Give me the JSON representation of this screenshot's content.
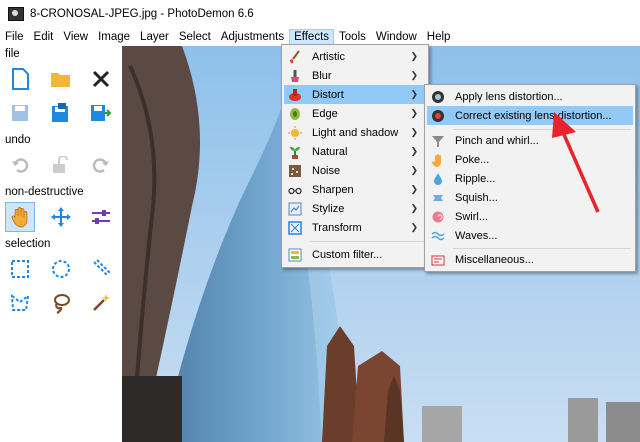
{
  "window": {
    "title": "8-CRONOSAL-JPEG.jpg - PhotoDemon 6.6"
  },
  "menubar": [
    "File",
    "Edit",
    "View",
    "Image",
    "Layer",
    "Select",
    "Adjustments",
    "Effects",
    "Tools",
    "Window",
    "Help"
  ],
  "toolbox": {
    "sections": {
      "file": "file",
      "undo": "undo",
      "nondestructive": "non-destructive",
      "selection": "selection"
    }
  },
  "effects_menu": [
    {
      "label": "Artistic",
      "icon": "palette-icon",
      "submenu": true
    },
    {
      "label": "Blur",
      "icon": "brush-icon",
      "submenu": true
    },
    {
      "label": "Distort",
      "icon": "distort-icon",
      "submenu": true
    },
    {
      "label": "Edge",
      "icon": "edge-icon",
      "submenu": true
    },
    {
      "label": "Light and shadow",
      "icon": "sun-icon",
      "submenu": true
    },
    {
      "label": "Natural",
      "icon": "plant-icon",
      "submenu": true
    },
    {
      "label": "Noise",
      "icon": "noise-icon",
      "submenu": true
    },
    {
      "label": "Sharpen",
      "icon": "glasses-icon",
      "submenu": true
    },
    {
      "label": "Stylize",
      "icon": "stylize-icon",
      "submenu": true
    },
    {
      "label": "Transform",
      "icon": "transform-icon",
      "submenu": true
    },
    {
      "label": "Custom filter...",
      "icon": "custom-filter-icon",
      "submenu": false
    }
  ],
  "distort_menu": [
    {
      "label": "Apply lens distortion...",
      "icon": "lens-icon"
    },
    {
      "label": "Correct existing lens distortion...",
      "icon": "lens-correct-icon"
    },
    {
      "label": "Pinch and whirl...",
      "icon": "funnel-icon"
    },
    {
      "label": "Poke...",
      "icon": "hand-icon"
    },
    {
      "label": "Ripple...",
      "icon": "drop-icon"
    },
    {
      "label": "Squish...",
      "icon": "squish-icon"
    },
    {
      "label": "Swirl...",
      "icon": "swirl-icon"
    },
    {
      "label": "Waves...",
      "icon": "waves-icon"
    },
    {
      "label": "Miscellaneous...",
      "icon": "misc-icon"
    }
  ],
  "colors": {
    "highlight": "#91c9f7",
    "menu_bg": "#f2f2f2",
    "arrow": "#e8232b"
  }
}
